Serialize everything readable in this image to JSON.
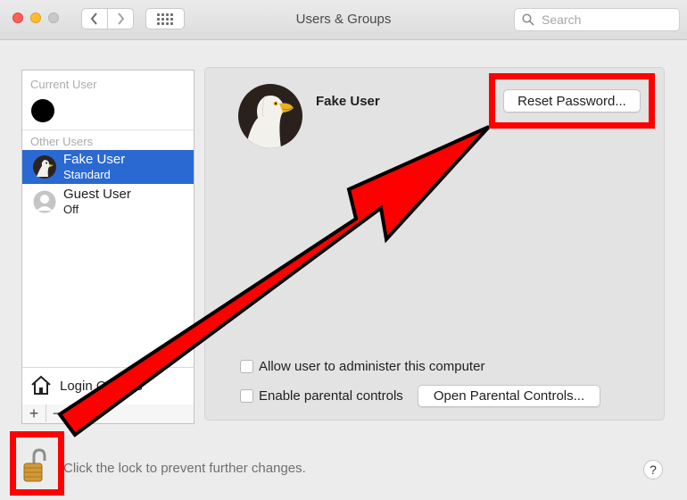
{
  "window": {
    "title": "Users & Groups"
  },
  "toolbar": {
    "back_icon": "chevron-left-icon",
    "forward_icon": "chevron-right-icon",
    "grid_icon": "show-all-grid-icon"
  },
  "search": {
    "placeholder": "Search"
  },
  "sidebar": {
    "current_user_header": "Current User",
    "other_users_header": "Other Users",
    "users": [
      {
        "name": "Fake User",
        "status": "Standard",
        "selected": true
      },
      {
        "name": "Guest User",
        "status": "Off",
        "selected": false
      }
    ],
    "login_options_label": "Login Options",
    "add_label": "+",
    "remove_label": "−"
  },
  "detail": {
    "full_name": "Fake User",
    "reset_password_label": "Reset Password...",
    "allow_admin_label": "Allow user to administer this computer",
    "allow_admin_checked": false,
    "parental_label": "Enable parental controls",
    "parental_checked": false,
    "open_parental_label": "Open Parental Controls..."
  },
  "footer": {
    "lock_text": "Click the lock to prevent further changes.",
    "help_label": "?"
  },
  "colors": {
    "selection": "#2a69d2",
    "highlight": "#ff0000",
    "window_bg": "#ececec"
  }
}
